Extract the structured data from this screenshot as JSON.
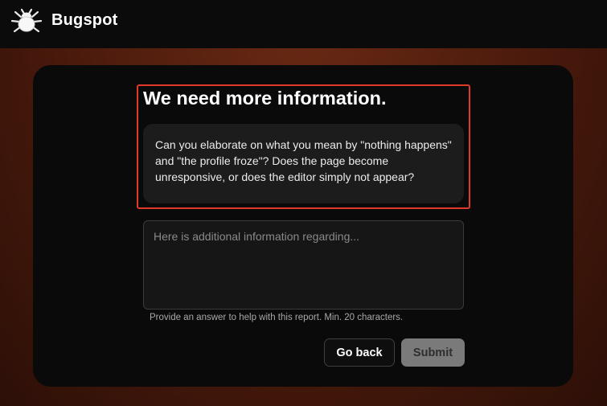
{
  "app": {
    "name": "Bugspot",
    "logo_icon": "bug-icon"
  },
  "prompt": {
    "heading": "We need more information.",
    "question": "Can you elaborate on what you mean by \"nothing happens\" and \"the profile froze\"? Does the page become unresponsive, or does the editor simply not appear?"
  },
  "answer": {
    "value": "",
    "placeholder": "Here is additional information regarding...",
    "helper": "Provide an answer to help with this report. Min. 20 characters."
  },
  "actions": {
    "back_label": "Go back",
    "submit_label": "Submit"
  },
  "colors": {
    "highlight": "#e0392a",
    "background_accent": "#5a2210",
    "card": "#0a0a0a"
  }
}
